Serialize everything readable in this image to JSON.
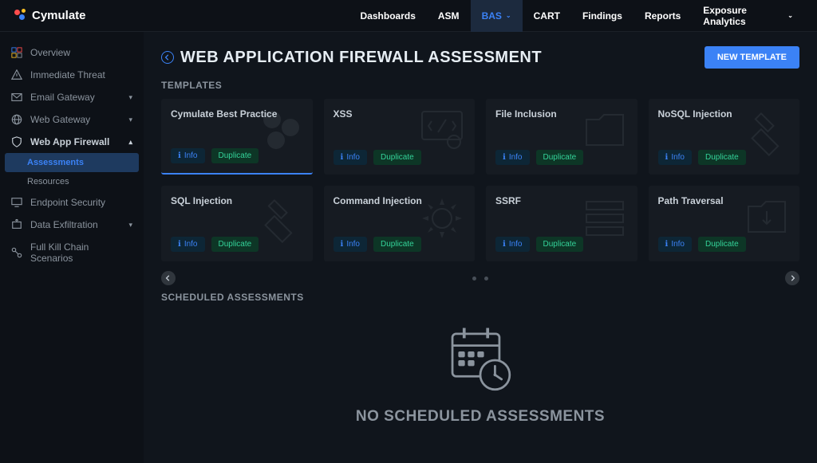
{
  "brand": "Cymulate",
  "topnav": {
    "items": [
      {
        "label": "Dashboards"
      },
      {
        "label": "ASM"
      },
      {
        "label": "BAS",
        "active": true,
        "hasDropdown": true
      },
      {
        "label": "CART"
      },
      {
        "label": "Findings"
      },
      {
        "label": "Reports"
      },
      {
        "label": "Exposure Analytics",
        "hasDropdown": true
      }
    ]
  },
  "sidebar": {
    "items": [
      {
        "label": "Overview",
        "icon": "overview"
      },
      {
        "label": "Immediate Threat",
        "icon": "alert"
      },
      {
        "label": "Email Gateway",
        "icon": "mail",
        "expandable": true
      },
      {
        "label": "Web Gateway",
        "icon": "globe",
        "expandable": true
      },
      {
        "label": "Web App Firewall",
        "icon": "shield",
        "expandable": true,
        "expanded": true,
        "bold": true,
        "children": [
          {
            "label": "Assessments",
            "active": true
          },
          {
            "label": "Resources"
          }
        ]
      },
      {
        "label": "Endpoint Security",
        "icon": "monitor"
      },
      {
        "label": "Data Exfiltration",
        "icon": "exfil",
        "expandable": true
      },
      {
        "label": "Full Kill Chain Scenarios",
        "icon": "chain"
      }
    ]
  },
  "page": {
    "title": "WEB APPLICATION FIREWALL ASSESSMENT",
    "newTemplateLabel": "NEW TEMPLATE",
    "templatesLabel": "TEMPLATES",
    "scheduledLabel": "SCHEDULED ASSESSMENTS",
    "emptyStateTitle": "NO SCHEDULED ASSESSMENTS",
    "infoLabel": "Info",
    "duplicateLabel": "Duplicate"
  },
  "templates": [
    {
      "title": "Cymulate Best Practice",
      "active": true
    },
    {
      "title": "XSS"
    },
    {
      "title": "File Inclusion"
    },
    {
      "title": "NoSQL Injection"
    },
    {
      "title": "SQL Injection"
    },
    {
      "title": "Command Injection"
    },
    {
      "title": "SSRF"
    },
    {
      "title": "Path Traversal"
    }
  ]
}
